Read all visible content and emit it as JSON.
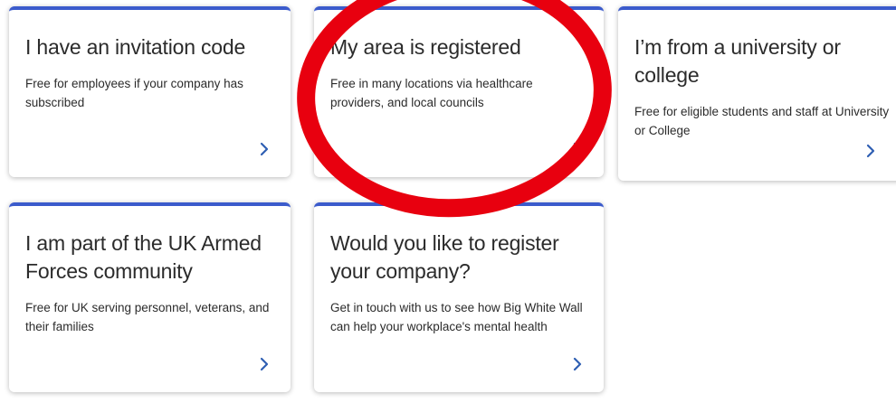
{
  "cards": [
    {
      "title": "I have an invitation code",
      "description": "Free for employees if your company has subscribed",
      "icon": "chevron-right-icon"
    },
    {
      "title": "My area is registered",
      "description": "Free in many locations via healthcare providers, and local councils",
      "icon": "chevron-right-icon"
    },
    {
      "title": "I’m from a university or college",
      "description": "Free for eligible students and staff at University or College",
      "icon": "chevron-right-icon"
    },
    {
      "title": "I am part of the UK Armed Forces community",
      "description": "Free for UK serving personnel, veterans, and their families",
      "icon": "chevron-right-icon"
    },
    {
      "title": "Would you like to register your company?",
      "description": "Get in touch with us to see how Big White Wall can help your workplace's mental health",
      "icon": "chevron-right-icon"
    }
  ],
  "colors": {
    "accent": "#3b5bcc",
    "chevron": "#2f5fb3",
    "highlight": "#e8000f",
    "text": "#2b2b2b"
  }
}
